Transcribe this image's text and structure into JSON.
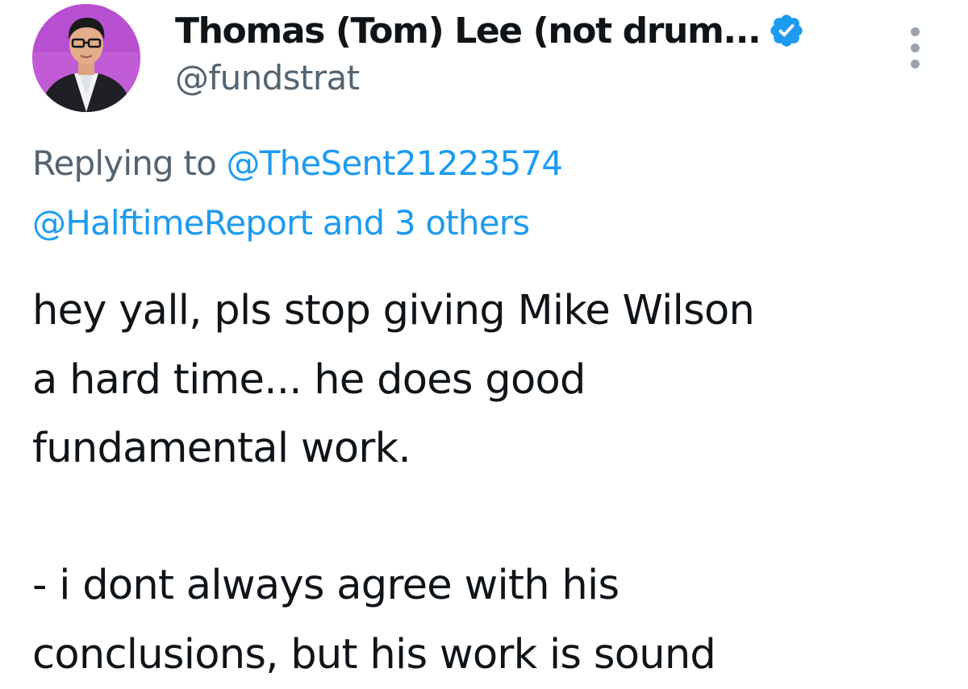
{
  "tweet": {
    "author": {
      "display_name": "Thomas (Tom) Lee (not drum...",
      "handle": "@fundstrat",
      "verified": true,
      "avatar_icon": "profile-photo-man-glasses-purple-background"
    },
    "reply_context": {
      "prefix": "Replying to",
      "mention_1": "@TheSent21223574",
      "mention_2": "@HalftimeReport",
      "suffix": "and 3 others"
    },
    "text_lines": [
      "hey yall, pls stop giving Mike Wilson",
      "a hard time... he does good",
      "fundamental work.",
      "- i dont always agree with his",
      "conclusions, but his work is sound"
    ]
  },
  "icons": {
    "verified": "verified-check-badge-icon",
    "more": "more-options-vertical-dots-icon"
  },
  "colors": {
    "accent": "#1d9bf0",
    "text_primary": "#0f1419",
    "text_secondary": "#536471",
    "avatar_background": "#c35cd8"
  }
}
